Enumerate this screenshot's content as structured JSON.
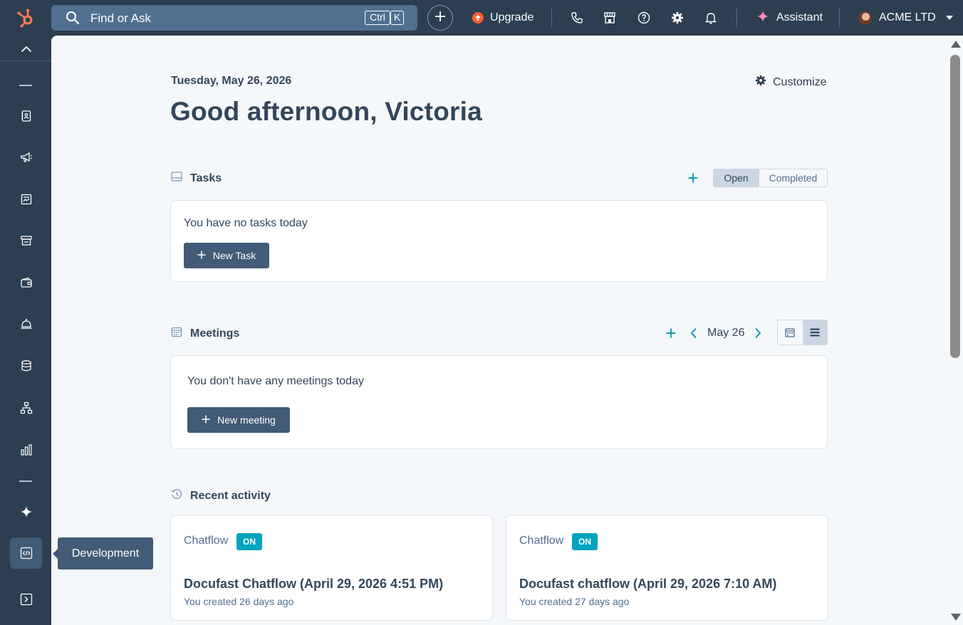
{
  "topbar": {
    "search_placeholder": "Find or Ask",
    "shortcut_ctrl": "Ctrl",
    "shortcut_k": "K",
    "upgrade_label": "Upgrade",
    "assistant_label": "Assistant",
    "account_name": "ACME LTD",
    "icons": [
      "hubspot-logo",
      "search",
      "plus",
      "upgrade-arrow",
      "phone",
      "marketplace",
      "help",
      "settings",
      "notifications",
      "sparkle",
      "avatar",
      "caret-down"
    ]
  },
  "sidebar": {
    "icons": [
      "chevron-up",
      "contacts",
      "marketing",
      "content",
      "commerce",
      "payments",
      "service",
      "data-management",
      "automation",
      "reporting",
      "breeze",
      "development",
      "expand"
    ],
    "tooltip": "Development"
  },
  "main": {
    "date": "Tuesday, May 26, 2026",
    "greeting": "Good afternoon, Victoria",
    "customize_label": "Customize",
    "tasks": {
      "title": "Tasks",
      "filter_open": "Open",
      "filter_completed": "Completed",
      "empty_text": "You have no tasks today",
      "new_button": "New Task"
    },
    "meetings": {
      "title": "Meetings",
      "date_label": "May 26",
      "empty_text": "You don't have any meetings today",
      "new_button": "New meeting"
    },
    "recent_activity": {
      "title": "Recent activity",
      "items": [
        {
          "type": "Chatflow",
          "status": "ON",
          "title": "Docufast Chatflow (April 29, 2026 4:51 PM)",
          "subtitle": "You created 26 days ago"
        },
        {
          "type": "Chatflow",
          "status": "ON",
          "title": "Docufast chatflow (April 29, 2026 7:10 AM)",
          "subtitle": "You created 27 days ago"
        }
      ]
    }
  },
  "colors": {
    "nav_bg": "#2d3e50",
    "main_bg": "#f5f8fa",
    "accent_teal": "#00a4bd",
    "button_dark": "#425b76",
    "brand_orange": "#ff5c35"
  }
}
